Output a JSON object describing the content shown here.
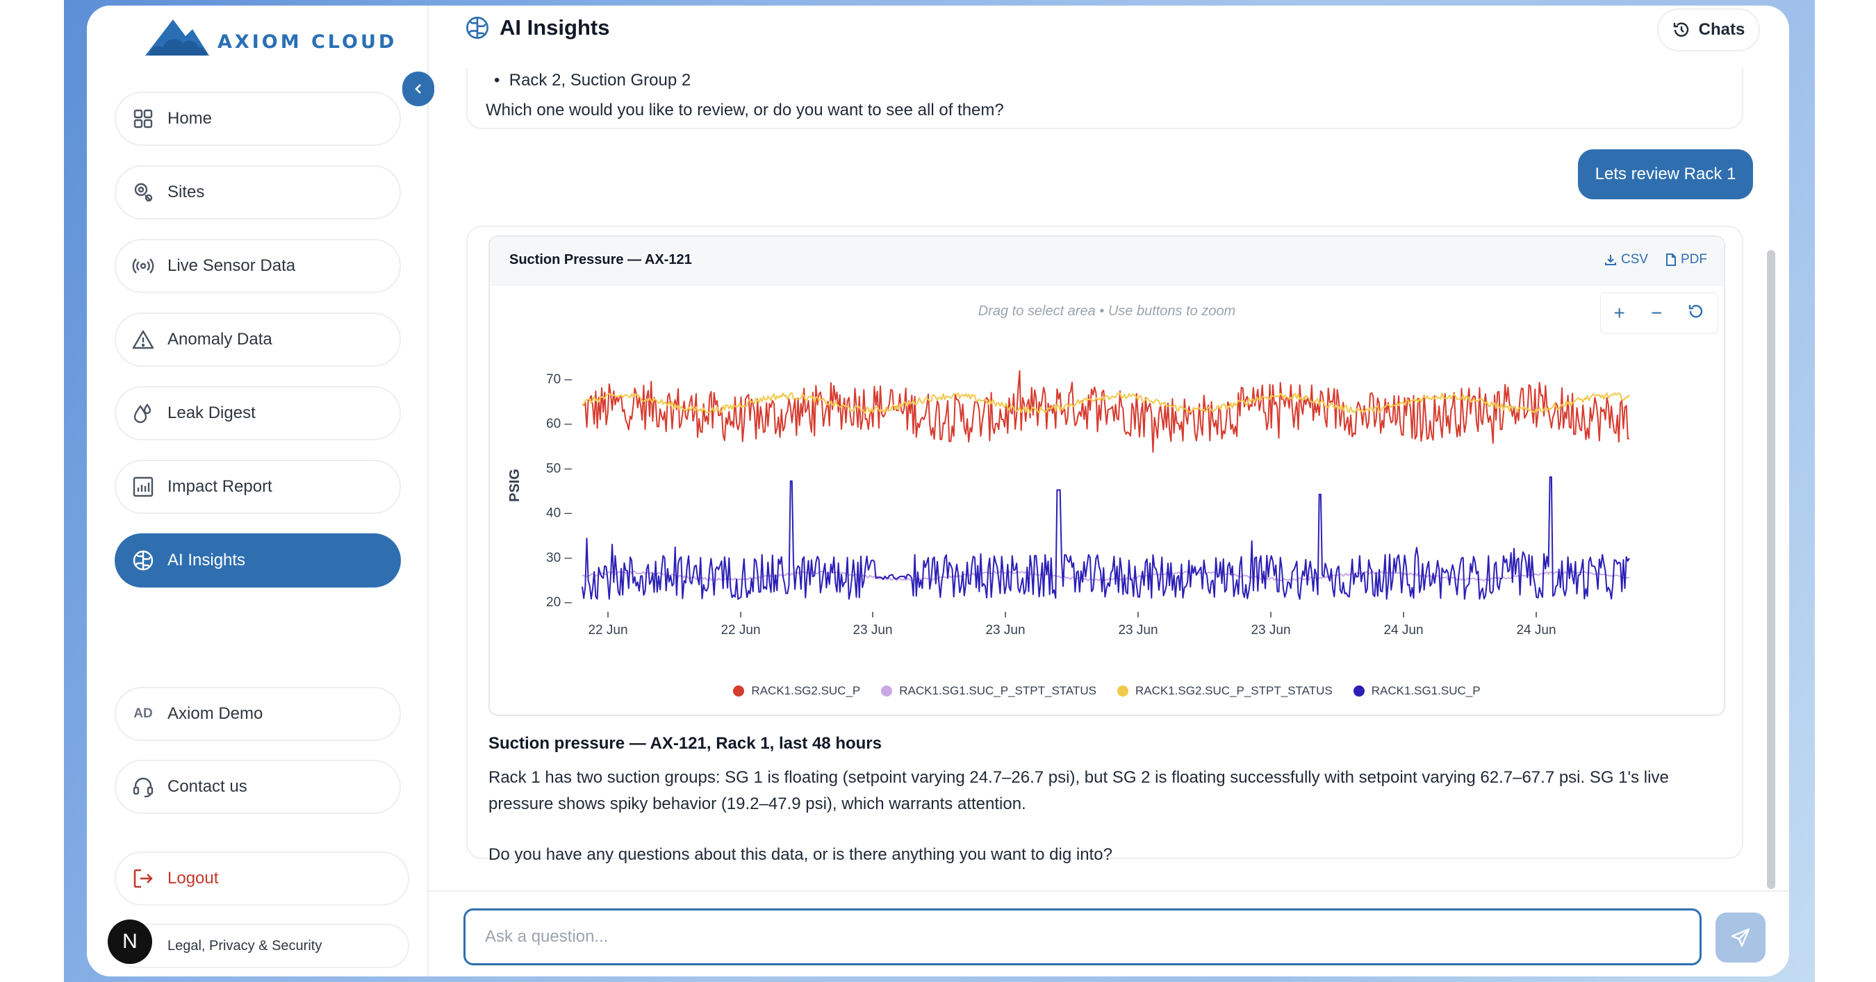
{
  "brand": {
    "name": "AXIOM CLOUD"
  },
  "sidebar": {
    "items": [
      {
        "label": "Home",
        "icon": "grid-icon"
      },
      {
        "label": "Sites",
        "icon": "map-pin-icon"
      },
      {
        "label": "Live Sensor Data",
        "icon": "broadcast-icon"
      },
      {
        "label": "Anomaly Data",
        "icon": "warning-icon"
      },
      {
        "label": "Leak Digest",
        "icon": "droplet-icon"
      },
      {
        "label": "Impact Report",
        "icon": "bar-chart-icon"
      },
      {
        "label": "AI Insights",
        "icon": "brain-icon",
        "active": true
      }
    ],
    "account": {
      "badge": "AD",
      "label": "Axiom Demo"
    },
    "contact": {
      "label": "Contact us"
    },
    "logout": {
      "label": "Logout"
    },
    "legal": {
      "avatar": "N",
      "label": "Legal, Privacy & Security"
    }
  },
  "header": {
    "title": "AI Insights",
    "chats_label": "Chats"
  },
  "conversation": {
    "assistant_1": {
      "bullet": "Rack 2, Suction Group 2",
      "question": "Which one would you like to review, or do you want to see all of them?"
    },
    "user_1": "Lets review Rack 1",
    "assistant_2": {
      "chart_card": {
        "title": "Suction Pressure — AX-121",
        "csv_label": "CSV",
        "pdf_label": "PDF",
        "hint": "Drag to select area • Use buttons to zoom",
        "zoom_in": "+",
        "zoom_out": "−"
      },
      "summary_title": "Suction pressure — AX-121, Rack 1, last 48 hours",
      "summary_text": "Rack 1 has two suction groups: SG 1 is floating (setpoint varying 24.7–26.7 psi), but SG 2 is floating successfully with setpoint varying 62.7–67.7 psi. SG 1's live pressure shows spiky behavior (19.2–47.9 psi), which warrants attention.",
      "followup": "Do you have any questions about this data, or is there anything you want to dig into?"
    }
  },
  "input": {
    "placeholder": "Ask a question..."
  },
  "colors": {
    "accent": "#2f6fb0",
    "sg2": "#d63b2f",
    "sg1_stpt": "#c9a8e8",
    "sg2_stpt": "#f2c94c",
    "sg1": "#2b1fb5"
  },
  "chart_data": {
    "type": "line",
    "ylabel": "PSIG",
    "xlabel": "",
    "yticks": [
      20,
      30,
      40,
      50,
      60,
      70
    ],
    "ylim": [
      20,
      70
    ],
    "xtick_labels": [
      "22 Jun",
      "22 Jun",
      "23 Jun",
      "23 Jun",
      "23 Jun",
      "23 Jun",
      "24 Jun",
      "24 Jun"
    ],
    "legend_position": "bottom",
    "series": [
      {
        "name": "RACK1.SG2.SUC_P",
        "color": "#d63b2f",
        "range": [
          54,
          69
        ],
        "mean": 62.5
      },
      {
        "name": "RACK1.SG1.SUC_P_STPT_STATUS",
        "color": "#c9a8e8",
        "range": [
          24.7,
          26.7
        ],
        "mean": 25.7
      },
      {
        "name": "RACK1.SG2.SUC_P_STPT_STATUS",
        "color": "#f2c94c",
        "range": [
          62.7,
          67.7
        ],
        "mean": 64.5
      },
      {
        "name": "RACK1.SG1.SUC_P",
        "color": "#2b1fb5",
        "range": [
          19.2,
          47.9
        ],
        "mean": 25.5,
        "spikes_at": [
          0.2,
          0.455,
          0.705,
          0.925
        ],
        "spike_values": [
          47,
          45,
          44,
          47.9
        ]
      }
    ]
  }
}
